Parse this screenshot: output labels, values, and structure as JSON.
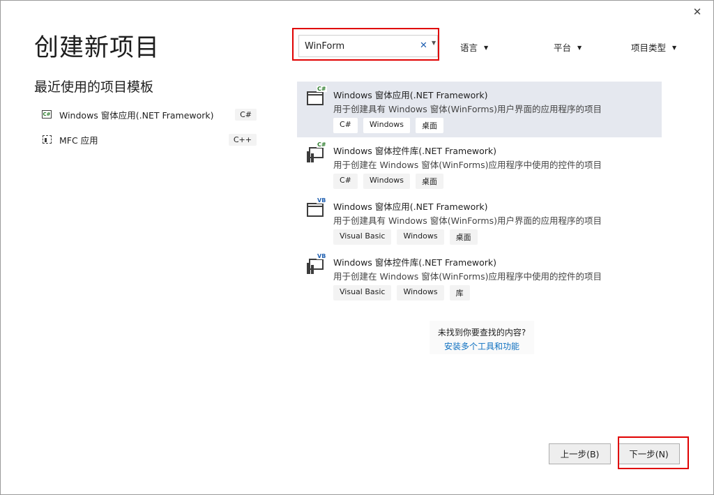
{
  "window": {
    "title": "创建新项目",
    "close_icon": "close-icon",
    "close_glyph": "✕"
  },
  "recent": {
    "title": "最近使用的项目模板",
    "items": [
      {
        "label": "Windows 窗体应用(.NET Framework)",
        "lang": "C#",
        "icon": "winforms-csharp-icon",
        "icon_text": "C#"
      },
      {
        "label": "MFC 应用",
        "lang": "C++",
        "icon": "mfc-app-icon"
      }
    ]
  },
  "search": {
    "value": "WinForm",
    "clear_glyph": "✕",
    "dropdown_glyph": "▼"
  },
  "filters": {
    "language": "语言",
    "platform": "平台",
    "project_type": "项目类型",
    "caret": "▼"
  },
  "templates": [
    {
      "name": "Windows 窗体应用(.NET Framework)",
      "desc": "用于创建具有 Windows 窗体(WinForms)用户界面的应用程序的项目",
      "tags": [
        "C#",
        "Windows",
        "桌面"
      ],
      "icon": "window-icon",
      "lang_mark": "C#"
    },
    {
      "name": "Windows 窗体控件库(.NET Framework)",
      "desc": "用于创建在 Windows 窗体(WinForms)应用程序中使用的控件的项目",
      "tags": [
        "C#",
        "Windows",
        "桌面"
      ],
      "icon": "control-library-icon",
      "lang_mark": "C#"
    },
    {
      "name": "Windows 窗体应用(.NET Framework)",
      "desc": "用于创建具有 Windows 窗体(WinForms)用户界面的应用程序的项目",
      "tags": [
        "Visual Basic",
        "Windows",
        "桌面"
      ],
      "icon": "window-icon",
      "lang_mark": "VB"
    },
    {
      "name": "Windows 窗体控件库(.NET Framework)",
      "desc": "用于创建在 Windows 窗体(WinForms)应用程序中使用的控件的项目",
      "tags": [
        "Visual Basic",
        "Windows",
        "库"
      ],
      "icon": "control-library-icon",
      "lang_mark": "VB"
    }
  ],
  "not_found": {
    "question": "未找到你要查找的内容?",
    "link": "安装多个工具和功能"
  },
  "buttons": {
    "back": "上一步(B)",
    "next": "下一步(N)"
  },
  "colors": {
    "highlight_box": "#e00000",
    "selected_row": "#e5e8ef",
    "link": "#0e70c0"
  }
}
